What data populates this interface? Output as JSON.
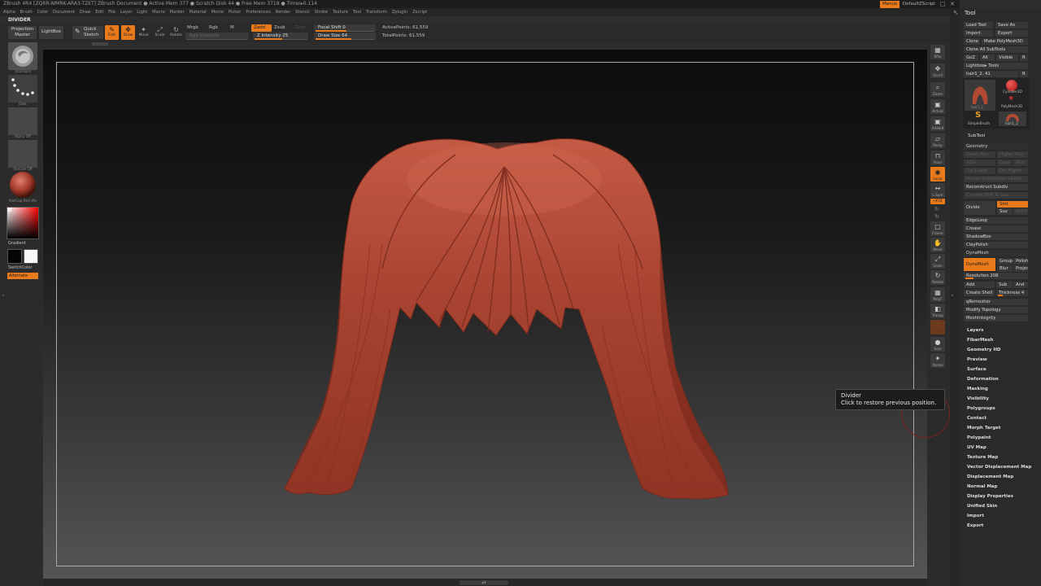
{
  "titlebar": {
    "text": "ZBrush 4R4 [ZQRR-WMRK-ARA3-TZET]   ZBrush Document     ● Active Mem 377 ● Scratch Disk 44 ● Free Mem 3718 ● Timer▸0.114"
  },
  "menus": [
    "Alpha",
    "Brush",
    "Color",
    "Document",
    "Draw",
    "Edit",
    "File",
    "Layer",
    "Light",
    "Macro",
    "Marker",
    "Material",
    "Movie",
    "Picker",
    "Preferences",
    "Render",
    "Stencil",
    "Stroke",
    "Texture",
    "Tool",
    "Transform",
    "Zplugin",
    "Zscript"
  ],
  "topright": {
    "menus_label": "Menus",
    "script_label": "DefaultZScript",
    "minimize": "–",
    "maximize": "□",
    "close": "✕"
  },
  "palette_title": "DIVIDER",
  "topshelf": {
    "projection_master_line1": "Projection",
    "projection_master_line2": "Master",
    "lightbox": "LightBox",
    "quick_sketch_line1": "Quick",
    "quick_sketch_line2": "Sketch",
    "icons": [
      {
        "label": "Edit",
        "glyph": "✎"
      },
      {
        "label": "Draw",
        "glyph": "✥"
      },
      {
        "label": "Move",
        "glyph": "✦"
      },
      {
        "label": "Scale",
        "glyph": "⤢"
      },
      {
        "label": "Rotate",
        "glyph": "↻"
      }
    ],
    "mrgb": "Mrgb",
    "rgb": "Rgb",
    "m": "M",
    "zadd": "Zadd",
    "zsub": "Zsub",
    "zcut": "Zcut",
    "rgb_intensity": "Rgb Intensity",
    "z_intensity": "Z Intensity 25",
    "focal_shift": "Focal Shift 0",
    "draw_size": "Draw Size 64",
    "active_points": "ActivePoints: 61,559",
    "total_points": "TotalPoints: 61,559"
  },
  "leftshelf": {
    "items": [
      {
        "caption": "Standard"
      },
      {
        "caption": "Dots"
      },
      {
        "caption": "Alpha Off"
      },
      {
        "caption": "Texture Off"
      },
      {
        "caption": "MatCap Red Wa"
      }
    ],
    "gradient": "Gradient",
    "switch_color": "SwitchColor",
    "alternate": "Alternate"
  },
  "rightshelf": [
    {
      "label": "SPix",
      "glyph": "▦"
    },
    {
      "label": "Scroll",
      "glyph": "✥"
    },
    {
      "label": "Zoom",
      "glyph": "⌕"
    },
    {
      "label": "Actual",
      "glyph": "▣"
    },
    {
      "label": "AAHalf",
      "glyph": "▣"
    },
    {
      "label": "Persp",
      "glyph": "▱"
    },
    {
      "label": "Floor",
      "glyph": "⊓"
    },
    {
      "label": "Local",
      "glyph": "◉"
    },
    {
      "label": "L.Sym",
      "glyph": "↔"
    },
    {
      "label": "Frame",
      "glyph": "▢"
    },
    {
      "label": "Move",
      "glyph": "✋"
    },
    {
      "label": "Scale",
      "glyph": "⤢"
    },
    {
      "label": "Rotate",
      "glyph": "↻"
    },
    {
      "label": "PolyF",
      "glyph": "▦"
    },
    {
      "label": "Transp",
      "glyph": "◧"
    },
    {
      "label": "Ghost",
      "glyph": "◌"
    },
    {
      "label": "Solo",
      "glyph": "●"
    },
    {
      "label": "Xpose",
      "glyph": "✦"
    }
  ],
  "rightshelf_xyz": "•XYZ",
  "tool_panel": {
    "title": "Tool",
    "buttons": {
      "load_tool": "Load Tool",
      "save_as": "Save As",
      "import": "Import",
      "export": "Export",
      "clone": "Clone",
      "make_polymesh3d": "Make PolyMesh3D",
      "clone_all_subtools": "Clone All SubTools",
      "goz": "GoZ",
      "all": "All",
      "visible": "Visible",
      "r": "R",
      "lightbox_tools": "Lightbox▸ Tools",
      "current_tool": "hair1_2. 41",
      "r2": "R"
    },
    "tool_thumbs": [
      {
        "label": "hair1_2"
      },
      {
        "label": "Cylinder3D"
      },
      {
        "label": "PolyMesh3D"
      },
      {
        "label": "SimpleBrush"
      },
      {
        "label": "hair1_2"
      }
    ],
    "subtool": "SubTool",
    "geometry_header": "Geometry",
    "geometry": {
      "lower_res": "Lower Res",
      "higher_res": "Higher Res",
      "sdiv": "SDiv",
      "cage": "Cage",
      "rstr": "Rstr",
      "del_lower": "Del Lower",
      "del_higher": "Del Higher",
      "freeze_subdiv": "Freeze SubDivision Levels",
      "reconstruct_subdiv": "Reconstruct Subdiv",
      "convert_bpr": "Convert BPR To Geo",
      "divide": "Divide",
      "smt": "Smt",
      "suv": "Suv",
      "relr": "ReUV"
    },
    "geometry_items": [
      "EdgeLoop",
      "Crease",
      "ShadowBox",
      "ClayPolish"
    ],
    "dynamesh_header": "DynaMesh",
    "dynamesh": {
      "dynamesh": "DynaMesh",
      "group": "Group",
      "polish": "Polish",
      "blur": "Blur",
      "project": "Project",
      "resolution": "Resolution 208",
      "add": "Add",
      "sub": "Sub",
      "and": "And",
      "create_shell": "Create Shell",
      "thickness": "Thickness 4"
    },
    "after_dyna": [
      "qRemesher",
      "Modify Topology",
      "MeshIntegrity"
    ],
    "subpalettes": [
      "Layers",
      "FiberMesh",
      "Geometry HD",
      "Preview",
      "Surface",
      "Deformation",
      "Masking",
      "Visibility",
      "Polygroups",
      "Contact",
      "Morph Target",
      "Polypaint",
      "UV Map",
      "Texture Map",
      "Vector Displacement Map",
      "Displacement Map",
      "Normal Map",
      "Display Properties",
      "Unified Skin",
      "Import",
      "Export"
    ]
  },
  "tooltip": {
    "title": "Divider",
    "text": "Click to restore previous position."
  },
  "bottom_handle": "▴▾",
  "colors": {
    "accent": "#e87a1c",
    "hair": "#b04a35",
    "panel": "#2a2a2a",
    "button": "#383838"
  }
}
